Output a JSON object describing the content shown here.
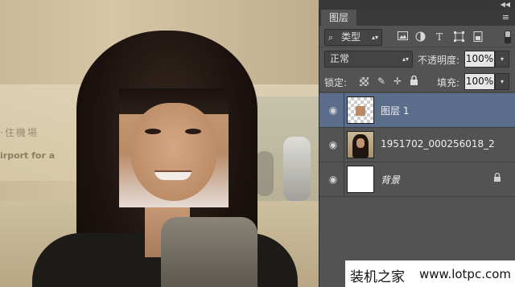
{
  "canvas": {
    "sign_line1": "·住機場",
    "sign_line2": "irport for a"
  },
  "window": {
    "collapse_glyph": "◀◀"
  },
  "panel": {
    "tab_title": "图层",
    "menu_glyph": "≡",
    "filter": {
      "type_label": "类型",
      "icons": [
        "image-filter-icon",
        "adjustment-filter-icon",
        "text-filter-icon",
        "shape-filter-icon",
        "smart-object-filter-icon"
      ]
    },
    "blend": {
      "mode": "正常",
      "opacity_label": "不透明度:",
      "opacity_value": "100%"
    },
    "lock": {
      "label": "锁定:",
      "fill_label": "填充:",
      "fill_value": "100%"
    },
    "layers": [
      {
        "name": "图层 1",
        "selected": true,
        "thumb": "transparent-face"
      },
      {
        "name": "1951702_000256018_2",
        "selected": false,
        "thumb": "photo"
      },
      {
        "name": "背景",
        "selected": false,
        "thumb": "white",
        "locked": true
      }
    ]
  },
  "watermark": {
    "site_name": "装机之家",
    "url": "www.lotpc.com"
  },
  "colors": {
    "panel_bg": "#535353",
    "selected_layer": "#5a6e8c",
    "tab_bar": "#3a3a3a"
  }
}
